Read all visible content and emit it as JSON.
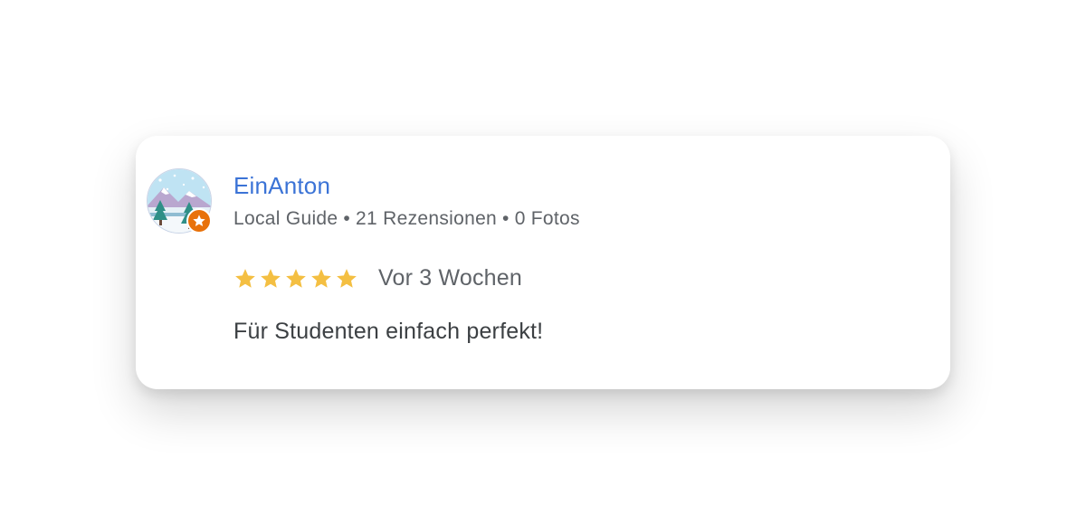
{
  "review": {
    "author": {
      "name": "EinAnton",
      "guide_label": "Local Guide",
      "reviews": "21 Rezensionen",
      "photos": "0 Fotos",
      "separator": "•"
    },
    "rating": 5,
    "rating_max": 5,
    "time": "Vor 3 Wochen",
    "text": "Für Studenten einfach perfekt!"
  },
  "colors": {
    "author_link": "#3b73d6",
    "star": "#f4bf42",
    "badge": "#e8710a",
    "secondary_text": "#5f6368",
    "body_text": "#3c4043"
  },
  "icons": {
    "avatar": "winter-landscape-avatar",
    "badge": "local-guide-star-badge-icon",
    "star": "star-icon"
  }
}
